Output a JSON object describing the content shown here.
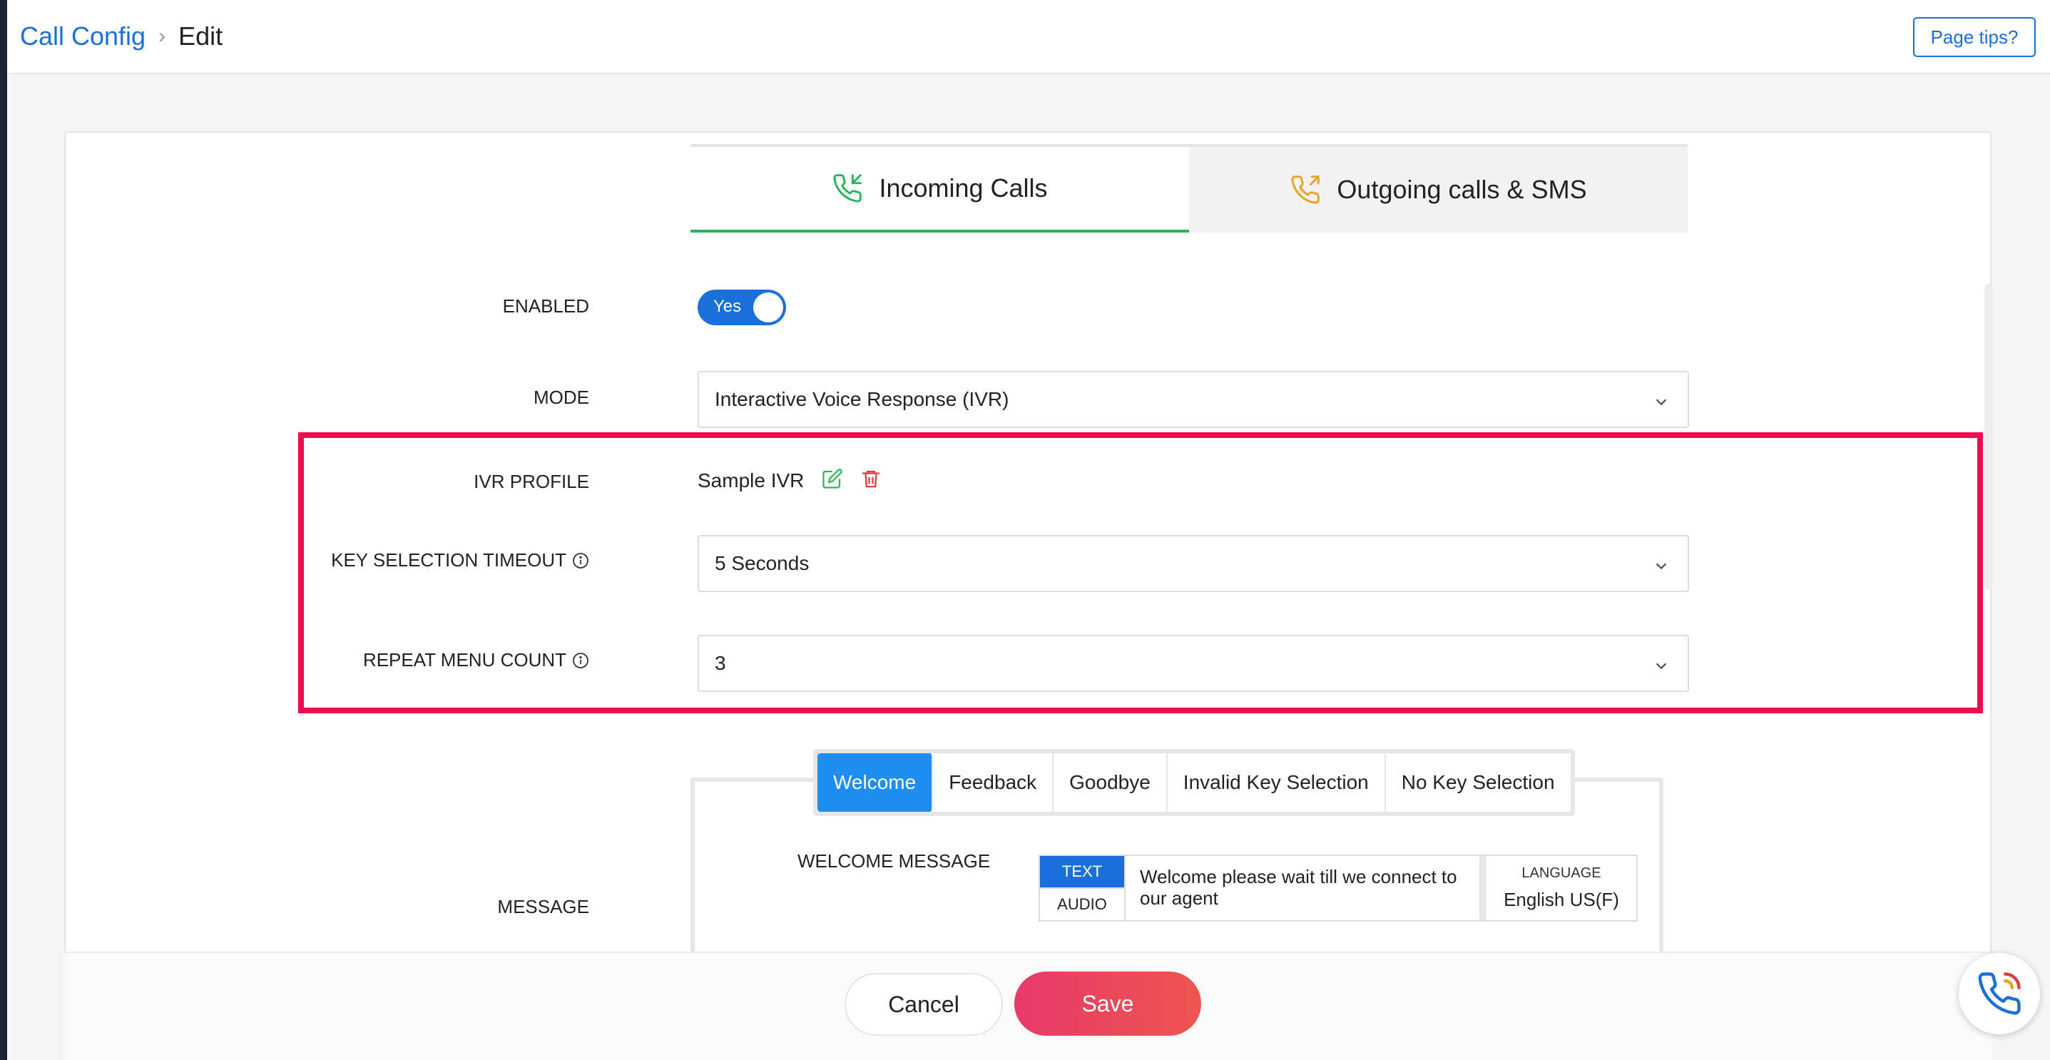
{
  "header": {
    "breadcrumb_root": "Call Config",
    "breadcrumb_separator": "›",
    "breadcrumb_current": "Edit",
    "tips_button": "Page tips?"
  },
  "tabs": [
    {
      "label": "Incoming Calls",
      "icon": "incoming-call-icon",
      "active": true
    },
    {
      "label": "Outgoing calls & SMS",
      "icon": "outgoing-call-icon",
      "active": false
    }
  ],
  "form": {
    "enabled_label": "ENABLED",
    "enabled_value": "Yes",
    "mode_label": "MODE",
    "mode_value": "Interactive Voice Response (IVR)",
    "ivr_profile_label": "IVR PROFILE",
    "ivr_profile_value": "Sample IVR",
    "key_timeout_label": "KEY SELECTION TIMEOUT",
    "key_timeout_value": "5 Seconds",
    "repeat_menu_label": "REPEAT MENU COUNT",
    "repeat_menu_value": "3",
    "message_label": "MESSAGE"
  },
  "message_tabs": [
    {
      "label": "Welcome",
      "active": true
    },
    {
      "label": "Feedback",
      "active": false
    },
    {
      "label": "Goodbye",
      "active": false
    },
    {
      "label": "Invalid Key Selection",
      "active": false
    },
    {
      "label": "No Key Selection",
      "active": false
    }
  ],
  "welcome": {
    "label": "WELCOME MESSAGE",
    "type_text": "TEXT",
    "type_audio": "AUDIO",
    "text": "Welcome please wait till we connect to our agent",
    "language_label": "LANGUAGE",
    "language_value": "English US(F)"
  },
  "footer": {
    "cancel": "Cancel",
    "save": "Save"
  },
  "colors": {
    "primary": "#1a6fd8",
    "active_tab_underline": "#2bb35b",
    "highlight": "#ea0f4e",
    "save_button": "#e73a6a",
    "message_tab_active": "#1f8ef1"
  }
}
